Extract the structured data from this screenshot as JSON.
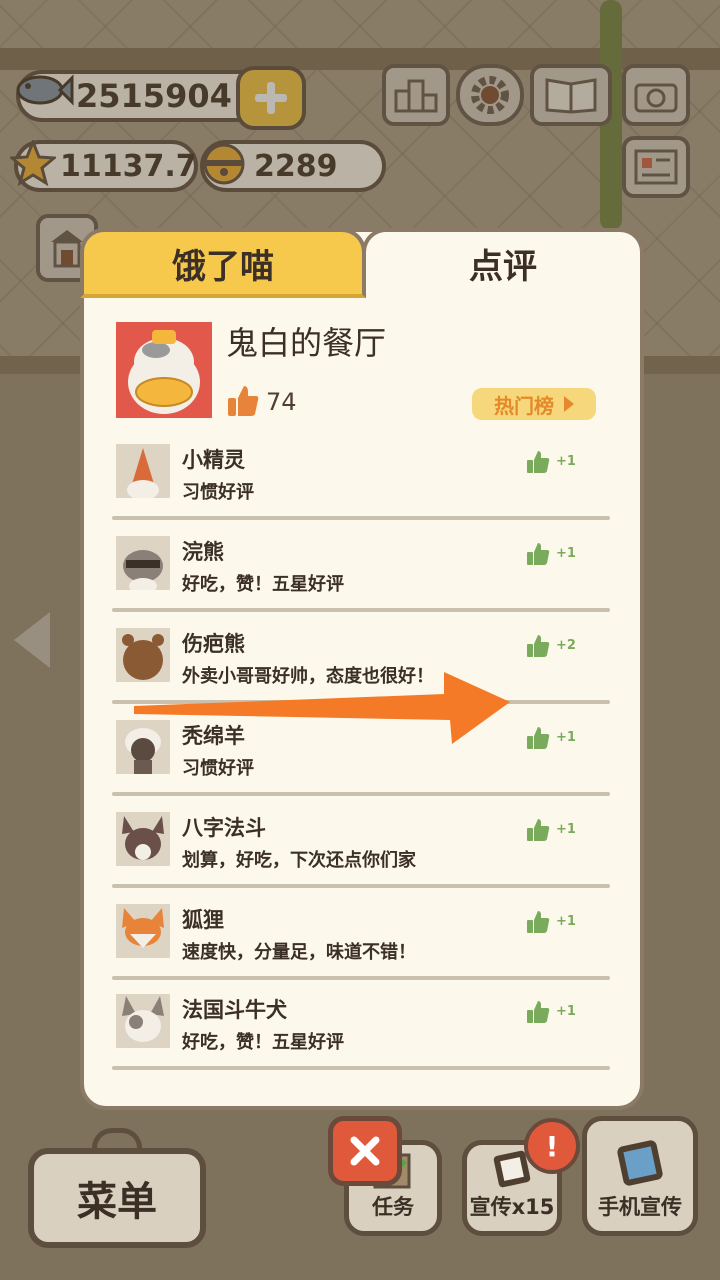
{
  "currency": {
    "fish": "2515904",
    "stars": "11137.7",
    "bells": "2289"
  },
  "tabs": {
    "hungry": "饿了喵",
    "review": "点评"
  },
  "restaurant": {
    "name": "鬼白的餐厅",
    "likes": "74",
    "hot_label": "热门榜"
  },
  "reviews": [
    {
      "name": "小精灵",
      "comment": "习惯好评",
      "likes": "+1",
      "avatar": "gnome-avatar"
    },
    {
      "name": "浣熊",
      "comment": "好吃，赞！五星好评",
      "likes": "+1",
      "avatar": "raccoon-avatar"
    },
    {
      "name": "伤疤熊",
      "comment": "外卖小哥哥好帅，态度也很好！",
      "likes": "+2",
      "avatar": "bear-avatar"
    },
    {
      "name": "秃绵羊",
      "comment": "习惯好评",
      "likes": "+1",
      "avatar": "sheep-avatar"
    },
    {
      "name": "八字法斗",
      "comment": "划算，好吃，下次还点你们家",
      "likes": "+1",
      "avatar": "bulldog-avatar"
    },
    {
      "name": "狐狸",
      "comment": "速度快，分量足，味道不错！",
      "likes": "+1",
      "avatar": "fox-avatar"
    },
    {
      "name": "法国斗牛犬",
      "comment": "好吃，赞！五星好评",
      "likes": "+1",
      "avatar": "frenchie-avatar"
    }
  ],
  "bottom": {
    "menu": "菜单",
    "task": "任务",
    "promo": "宣传x15",
    "phone_promo": "手机宣传",
    "alert": "!"
  },
  "colors": {
    "accent_yellow": "#f6c84c",
    "panel": "#fdf8ec",
    "like_green": "#7aaa5c",
    "like_orange": "#e8843a",
    "close_red": "#e0593a",
    "arrow_orange": "#f47a28"
  }
}
